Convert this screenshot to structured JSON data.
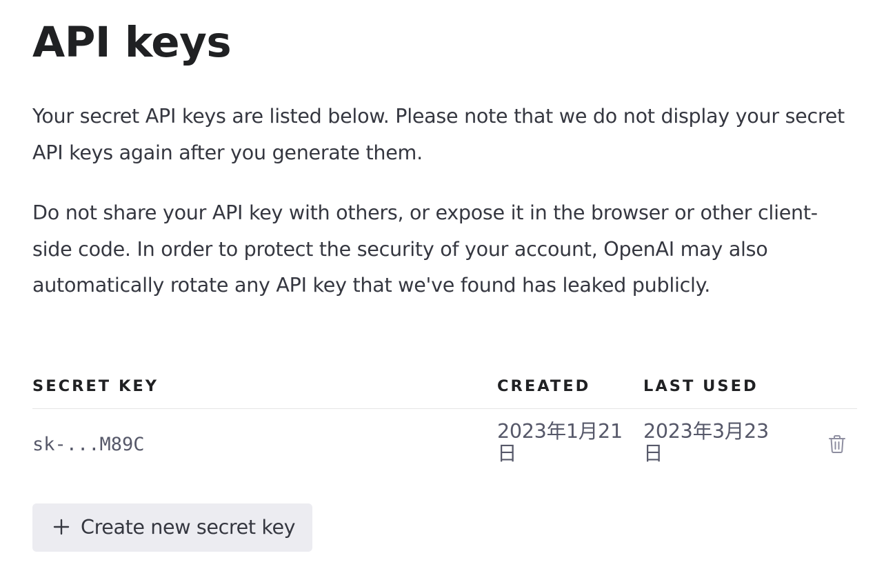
{
  "page": {
    "title": "API keys",
    "description": "Your secret API keys are listed below. Please note that we do not display your secret API keys again after you generate them.",
    "warning": "Do not share your API key with others, or expose it in the browser or other client-side code. In order to protect the security of your account, OpenAI may also automatically rotate any API key that we've found has leaked publicly."
  },
  "table": {
    "columns": {
      "secret_key": "SECRET KEY",
      "created": "CREATED",
      "last_used": "LAST USED"
    },
    "rows": [
      {
        "secret_key": "sk-...M89C",
        "created": "2023年1月21日",
        "last_used": "2023年3月23日",
        "delete_icon": "trash-icon"
      }
    ]
  },
  "actions": {
    "create_icon": "plus-icon",
    "create_label": "Create new secret key"
  },
  "colors": {
    "heading": "#202123",
    "body_text": "#353740",
    "muted_text": "#565869",
    "icon": "#8e8ea0",
    "divider": "#e5e5e5",
    "button_bg": "#ececf1"
  }
}
